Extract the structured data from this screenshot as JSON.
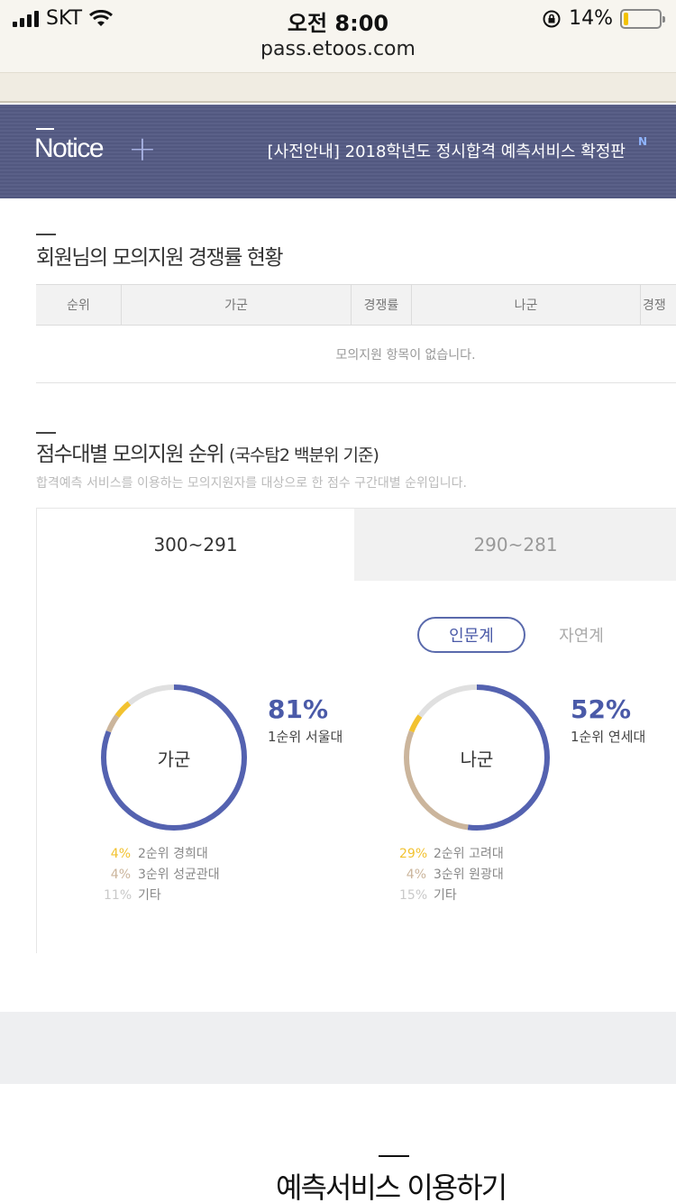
{
  "status_bar": {
    "carrier": "SKT",
    "time": "오전 8:00",
    "battery": "14%",
    "battery_level": 0.14
  },
  "browser": {
    "url": "pass.etoos.com"
  },
  "notice": {
    "title": "Notice",
    "plus": "+",
    "text": "[사전안내] 2018학년도 정시합격 예측서비스 확정판",
    "badge": "N"
  },
  "competition": {
    "title": "회원님의 모의지원 경쟁률 현황",
    "columns": [
      "순위",
      "가군",
      "경쟁률",
      "나군",
      "경쟁"
    ],
    "empty": "모의지원 항목이 없습니다."
  },
  "ranking": {
    "title": "점수대별 모의지원 순위",
    "title_sub": "(국수탐2 백분위 기준)",
    "desc": "합격예측 서비스를 이용하는 모의지원자를 대상으로 한 점수 구간대별 순위입니다.",
    "tabs": [
      "300~291",
      "290~281"
    ],
    "toggle": [
      "인문계",
      "자연계"
    ],
    "groups": [
      {
        "label": "가군",
        "top_pct": "81%",
        "top_label": "1순위 서울대",
        "segments": [
          81,
          4,
          4,
          11
        ],
        "legend": [
          {
            "pct": "4%",
            "label": "2순위 경희대",
            "color": "#f2c230"
          },
          {
            "pct": "4%",
            "label": "3순위 성균관대",
            "color": "#cbb59c"
          },
          {
            "pct": "11%",
            "label": "기타",
            "color": "#c9c9c9"
          }
        ]
      },
      {
        "label": "나군",
        "top_pct": "52%",
        "top_label": "1순위 연세대",
        "segments": [
          52,
          29,
          4,
          15
        ],
        "legend": [
          {
            "pct": "29%",
            "label": "2순위 고려대",
            "color": "#f2c230"
          },
          {
            "pct": "4%",
            "label": "3순위 원광대",
            "color": "#cbb59c"
          },
          {
            "pct": "15%",
            "label": "기타",
            "color": "#c9c9c9"
          }
        ]
      }
    ],
    "segment_colors": [
      "#5462b0",
      "#cbb59c",
      "#f2c230",
      "#e0e0e0"
    ]
  },
  "bottom": {
    "title": "예측서비스 이용하기"
  }
}
